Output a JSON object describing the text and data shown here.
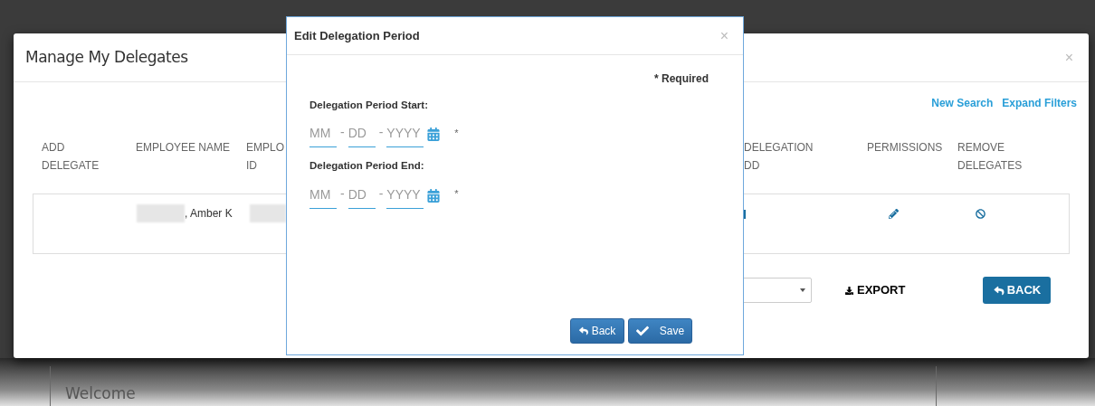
{
  "main_modal": {
    "title": "Manage My Delegates",
    "close": "×",
    "links": [
      "New Search",
      "Expand Filters"
    ],
    "table": {
      "columns": [
        {
          "lines": [
            "ADD",
            "DELEGATE"
          ]
        },
        {
          "lines": [
            "EMPLOYEE NAME"
          ]
        },
        {
          "lines": [
            "EMPLO",
            "ID"
          ]
        },
        {
          "lines": [
            "DELEGATION",
            "DD"
          ]
        },
        {
          "lines": [
            "PERMISSIONS"
          ]
        },
        {
          "lines": [
            "REMOVE",
            "DELEGATES"
          ]
        }
      ],
      "rows": [
        {
          "employee_name": ", Amber K"
        }
      ]
    },
    "export": "EXPORT",
    "back": "BACK"
  },
  "dialog": {
    "title": "Edit Delegation Period",
    "close": "×",
    "required_note": "* Required",
    "fields": [
      {
        "label": "Delegation Period Start:",
        "parts": [
          {
            "placeholder": "MM"
          },
          {
            "prefix": "-",
            "placeholder": "DD"
          },
          {
            "prefix": "-",
            "placeholder": "YYYY"
          }
        ],
        "required_mark": "*"
      },
      {
        "label": "Delegation Period End:",
        "parts": [
          {
            "placeholder": "MM"
          },
          {
            "prefix": "-",
            "placeholder": "DD"
          },
          {
            "prefix": "-",
            "placeholder": "YYYY"
          }
        ],
        "required_mark": "*"
      }
    ],
    "buttons": [
      {
        "kind": "back",
        "label": "Back"
      },
      {
        "kind": "save",
        "label": "Save"
      }
    ]
  },
  "background": {
    "welcome": "Welcome"
  }
}
